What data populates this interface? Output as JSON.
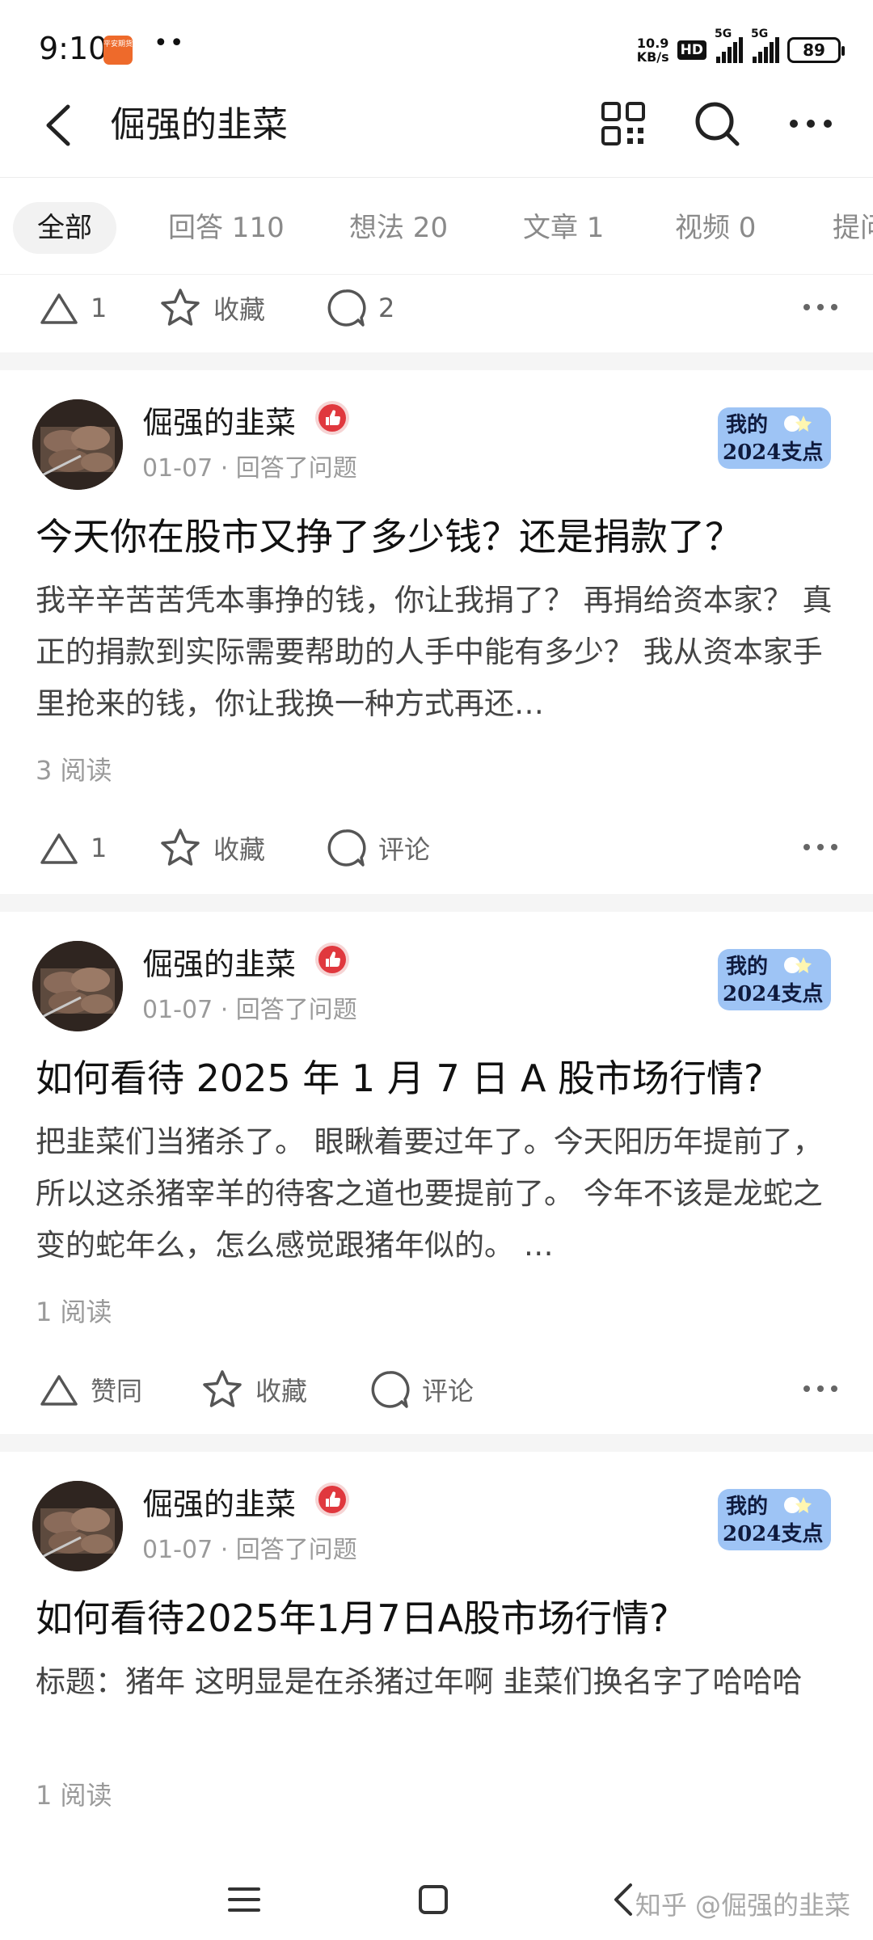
{
  "status_bar": {
    "time": "9:10",
    "app_icon_text": "平安期货",
    "dots": "••",
    "speed": "10.9",
    "speed_unit": "KB/s",
    "hd": "HD",
    "net1": "5G",
    "net2": "5G",
    "battery": "89"
  },
  "header": {
    "title": "倔强的韭菜"
  },
  "tabs": [
    {
      "label": "全部"
    },
    {
      "label": "回答 110"
    },
    {
      "label": "想法 20"
    },
    {
      "label": "文章 1"
    },
    {
      "label": "视频 0"
    },
    {
      "label": "提问"
    }
  ],
  "top_actions": {
    "likes": "1",
    "favorite": "收藏",
    "comments": "2"
  },
  "cards": [
    {
      "author": "倔强的韭菜",
      "meta": "01-07 · 回答了问题",
      "sticker_top": "我的",
      "sticker_bottom": "2024支点",
      "title": "今天你在股市又挣了多少钱？还是捐款了？",
      "body": "我辛辛苦苦凭本事挣的钱，你让我捐了？ 再捐给资本家？ 真正的捐款到实际需要帮助的人手中能有多少？ 我从资本家手里抢来的钱，你让我换一种方式再还…",
      "reads": "3 阅读",
      "likes": "1",
      "favorite": "收藏",
      "comment": "评论"
    },
    {
      "author": "倔强的韭菜",
      "meta": "01-07 · 回答了问题",
      "sticker_top": "我的",
      "sticker_bottom": "2024支点",
      "title": "如何看待 2025 年 1 月 7 日 A 股市场行情?",
      "body": "把韭菜们当猪杀了。 眼瞅着要过年了。今天阳历年提前了，所以这杀猪宰羊的待客之道也要提前了。 今年不该是龙蛇之变的蛇年么，怎么感觉跟猪年似的。 …",
      "reads": "1 阅读",
      "likes": "赞同",
      "favorite": "收藏",
      "comment": "评论"
    },
    {
      "author": "倔强的韭菜",
      "meta": "01-07 · 回答了问题",
      "sticker_top": "我的",
      "sticker_bottom": "2024支点",
      "title": "如何看待2025年1月7日A股市场行情?",
      "body": "标题：猪年 这明显是在杀猪过年啊 韭菜们换名字了哈哈哈",
      "reads": "1 阅读"
    }
  ],
  "watermark": "知乎 @倔强的韭菜"
}
